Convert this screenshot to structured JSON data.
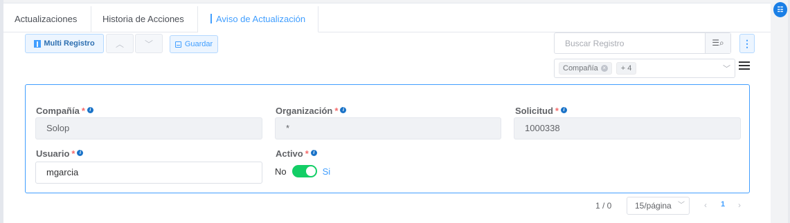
{
  "tabs": [
    {
      "label": "Actualizaciones",
      "active": false
    },
    {
      "label": "Historia de Acciones",
      "active": false
    },
    {
      "label": "Aviso de Actualización",
      "active": true
    }
  ],
  "toolbar": {
    "multi_record_label": "Multi Registro",
    "prev_symbol": "︿",
    "next_symbol": "﹀",
    "save_label": "Guardar",
    "more_symbol": "⋮"
  },
  "search": {
    "placeholder": "Buscar Registro",
    "button_symbol": "☰⌕"
  },
  "filter": {
    "chip_label": "Compañía",
    "chip_close": "×",
    "extra_count": "+ 4",
    "chevron": "﹀"
  },
  "form": {
    "company": {
      "label": "Compañía",
      "required": "*",
      "value": "Solop",
      "disabled": true
    },
    "organization": {
      "label": "Organización",
      "required": "*",
      "value": "*",
      "disabled": true
    },
    "request": {
      "label": "Solicitud",
      "required": "*",
      "value": "1000338",
      "disabled": true
    },
    "user": {
      "label": "Usuario",
      "required": "*",
      "value": "mgarcia",
      "disabled": false
    },
    "active": {
      "label": "Activo",
      "required": "*",
      "off_label": "No",
      "on_label": "Si",
      "value": true
    },
    "info_symbol": "i"
  },
  "pagination": {
    "count_text": "1 / 0",
    "page_size": "15/página",
    "current_page": "1",
    "prev_symbol": "‹",
    "next_symbol": "›"
  },
  "colors": {
    "primary": "#409eff",
    "toggle_on": "#13ce66",
    "required": "#f56c6c"
  }
}
